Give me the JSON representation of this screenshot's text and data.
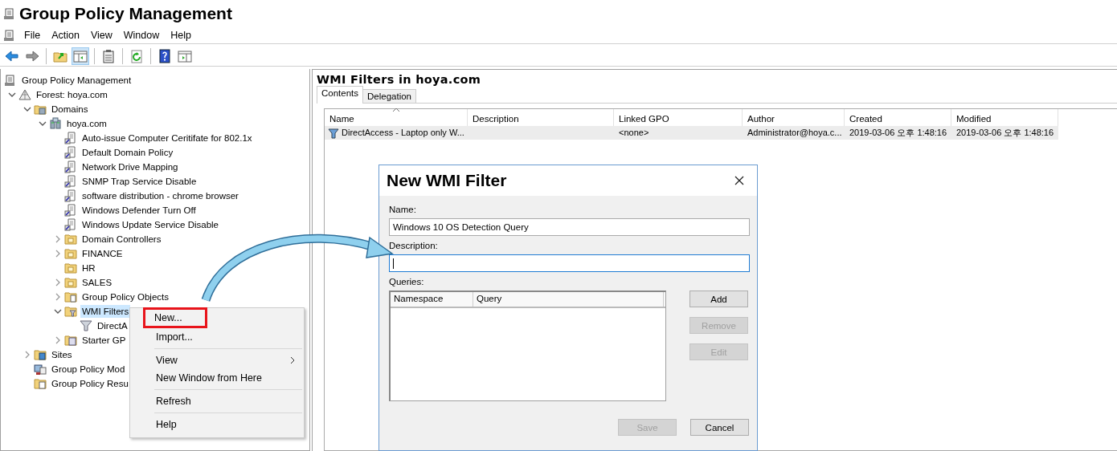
{
  "window": {
    "title": "Group Policy Management"
  },
  "menu": [
    "File",
    "Action",
    "View",
    "Window",
    "Help"
  ],
  "toolbar": [
    [
      {
        "kind": "back",
        "pressed": false
      },
      {
        "kind": "forward",
        "pressed": false
      }
    ],
    [
      {
        "kind": "up",
        "pressed": false
      },
      {
        "kind": "tree",
        "pressed": true
      }
    ],
    [
      {
        "kind": "clipboard",
        "pressed": false
      }
    ],
    [
      {
        "kind": "refresh",
        "pressed": false
      }
    ],
    [
      {
        "kind": "help",
        "pressed": false
      },
      {
        "kind": "panel",
        "pressed": false
      }
    ]
  ],
  "tree": {
    "label": "Group Policy Management",
    "kind": "root",
    "selected": false,
    "children": [
      {
        "label": "Forest: hoya.com",
        "kind": "forest",
        "expanded": true,
        "selected": false,
        "children": [
          {
            "label": "Domains",
            "kind": "domains",
            "expanded": true,
            "selected": false,
            "children": [
              {
                "label": "hoya.com",
                "kind": "domain",
                "expanded": true,
                "selected": false,
                "children": [
                  {
                    "label": "Auto-issue Computer Ceritifate for 802.1x",
                    "kind": "gpo",
                    "selected": false
                  },
                  {
                    "label": "Default Domain Policy",
                    "kind": "gpo",
                    "selected": false
                  },
                  {
                    "label": "Network Drive Mapping",
                    "kind": "gpo",
                    "selected": false
                  },
                  {
                    "label": "SNMP Trap Service Disable",
                    "kind": "gpo",
                    "selected": false
                  },
                  {
                    "label": "software distribution - chrome browser",
                    "kind": "gpo",
                    "selected": false
                  },
                  {
                    "label": "Windows Defender Turn Off",
                    "kind": "gpo",
                    "selected": false
                  },
                  {
                    "label": "Windows Update Service Disable",
                    "kind": "gpo",
                    "selected": false
                  },
                  {
                    "label": "Domain Controllers",
                    "kind": "ou",
                    "expanded": false,
                    "selected": false
                  },
                  {
                    "label": "FINANCE",
                    "kind": "ou",
                    "expanded": false,
                    "selected": false
                  },
                  {
                    "label": "HR",
                    "kind": "ou",
                    "selected": false
                  },
                  {
                    "label": "SALES",
                    "kind": "ou",
                    "expanded": false,
                    "selected": false
                  },
                  {
                    "label": "Group Policy Objects",
                    "kind": "gpo-folder",
                    "expanded": false,
                    "selected": false
                  },
                  {
                    "label": "WMI Filters",
                    "kind": "wmi-folder",
                    "expanded": true,
                    "selected": true,
                    "children": [
                      {
                        "label": "DirectA",
                        "kind": "wmi",
                        "selected": false
                      }
                    ]
                  },
                  {
                    "label": "Starter GP",
                    "kind": "starter",
                    "expanded": false,
                    "selected": false
                  }
                ]
              }
            ]
          },
          {
            "label": "Sites",
            "kind": "sites",
            "expanded": false,
            "selected": false
          },
          {
            "label": "Group Policy Mod",
            "kind": "modeling",
            "selected": false
          },
          {
            "label": "Group Policy Resu",
            "kind": "results",
            "selected": false
          }
        ]
      }
    ]
  },
  "context_menu": {
    "groups": [
      [
        {
          "label": "New...",
          "highlighted": true,
          "submenu": false
        },
        {
          "label": "Import...",
          "highlighted": false,
          "submenu": false
        }
      ],
      [
        {
          "label": "View",
          "highlighted": false,
          "submenu": true
        },
        {
          "label": "New Window from Here",
          "highlighted": false,
          "submenu": false
        }
      ],
      [
        {
          "label": "Refresh",
          "highlighted": false,
          "submenu": false
        }
      ],
      [
        {
          "label": "Help",
          "highlighted": false,
          "submenu": false
        }
      ]
    ]
  },
  "details": {
    "title": "WMI Filters in hoya.com",
    "tabs": [
      {
        "label": "Contents",
        "selected": true
      },
      {
        "label": "Delegation",
        "selected": false
      }
    ],
    "columns": [
      {
        "label": "Name",
        "sorted": true
      },
      {
        "label": "Description",
        "sorted": false
      },
      {
        "label": "Linked GPO",
        "sorted": false
      },
      {
        "label": "Author",
        "sorted": false
      },
      {
        "label": "Created",
        "sorted": false
      },
      {
        "label": "Modified",
        "sorted": false
      }
    ],
    "rows": [
      {
        "selected": true,
        "name": "DirectAccess - Laptop only W...",
        "linked_gpo": "<none>",
        "author": "Administrator@hoya.c...",
        "created": "2019-03-06 오후 1:48:16",
        "modified": "2019-03-06 오후 1:48:16"
      }
    ]
  },
  "dialog": {
    "title": "New WMI Filter",
    "fields": [
      {
        "label": "Name:",
        "value": "Windows 10 OS Detection Query",
        "focused": false
      },
      {
        "label": "Description:",
        "focused": true
      }
    ],
    "queries_label": "Queries:",
    "query_columns": [
      "Namespace",
      "Query"
    ],
    "side_buttons": [
      {
        "label": "Add",
        "disabled": false
      },
      {
        "label": "Remove",
        "disabled": true
      },
      {
        "label": "Edit",
        "disabled": true
      }
    ],
    "footer_buttons": [
      {
        "label": "Save",
        "disabled": true
      },
      {
        "label": "Cancel",
        "disabled": false
      }
    ]
  }
}
